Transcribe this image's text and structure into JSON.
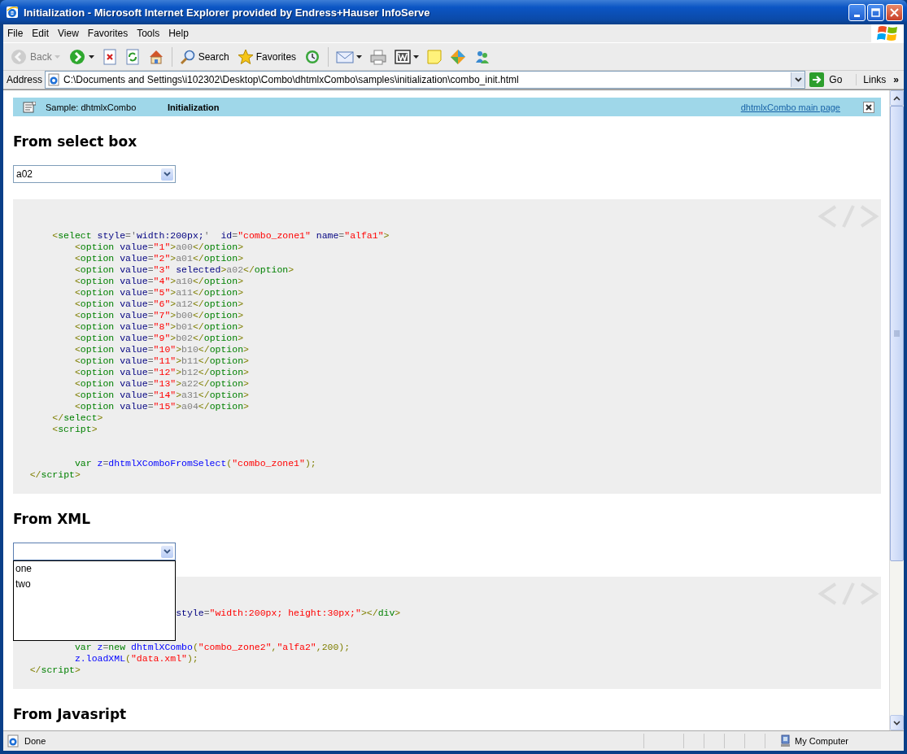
{
  "window": {
    "title": "Initialization - Microsoft Internet Explorer provided by Endress+Hauser InfoServe"
  },
  "menu": [
    "File",
    "Edit",
    "View",
    "Favorites",
    "Tools",
    "Help"
  ],
  "toolbar": [
    {
      "kind": "back",
      "label": "Back",
      "disabled": true,
      "menu": true
    },
    {
      "kind": "forward",
      "disabled": false,
      "menu": true
    },
    {
      "kind": "stop",
      "disabled": false,
      "menu": false
    },
    {
      "kind": "refresh",
      "disabled": false,
      "menu": false
    },
    {
      "kind": "home",
      "disabled": false,
      "menu": false
    },
    {
      "kind": "separator"
    },
    {
      "kind": "search",
      "label": "Search",
      "disabled": false,
      "menu": false
    },
    {
      "kind": "favorites",
      "label": "Favorites",
      "disabled": false,
      "menu": false
    },
    {
      "kind": "history",
      "disabled": false,
      "menu": false
    },
    {
      "kind": "separator"
    },
    {
      "kind": "mail",
      "disabled": false,
      "menu": true
    },
    {
      "kind": "print",
      "disabled": false,
      "menu": false
    },
    {
      "kind": "word",
      "disabled": false,
      "menu": true
    },
    {
      "kind": "note",
      "disabled": false,
      "menu": false
    },
    {
      "kind": "messenger",
      "disabled": false,
      "menu": false
    },
    {
      "kind": "people",
      "disabled": false,
      "menu": false
    }
  ],
  "address": {
    "label": "Address",
    "url": "C:\\Documents and Settings\\i102302\\Desktop\\Combo\\dhtmlxCombo\\samples\\initialization\\combo_init.html",
    "go": "Go",
    "links": "Links",
    "more": "»"
  },
  "sample_bar": {
    "caption": "Sample: dhtmlxCombo",
    "title": "Initialization",
    "link": "dhtmlxCombo main page"
  },
  "sections": [
    {
      "heading": "From select box",
      "combo": {
        "value": "a02",
        "open": false
      },
      "code": [
        {
          "tokens": [
            {
              "kind": "punct",
              "text": "       <"
            },
            {
              "kind": "tag",
              "text": "select"
            },
            {
              "kind": "attr",
              "text": " style"
            },
            {
              "kind": "op",
              "text": "='"
            },
            {
              "kind": "attr",
              "text": "width:200px;"
            },
            {
              "kind": "op",
              "text": "'"
            },
            {
              "kind": "attr",
              "text": "  id"
            },
            {
              "kind": "op",
              "text": "="
            },
            {
              "kind": "str",
              "text": "\"combo_zone1\""
            },
            {
              "kind": "attr",
              "text": " name"
            },
            {
              "kind": "op",
              "text": "="
            },
            {
              "kind": "str",
              "text": "\"alfa1\""
            },
            {
              "kind": "punct",
              "text": ">"
            }
          ]
        },
        {
          "tokens": [
            {
              "kind": "punct",
              "text": "           <"
            },
            {
              "kind": "tag",
              "text": "option"
            },
            {
              "kind": "attr",
              "text": " value"
            },
            {
              "kind": "op",
              "text": "="
            },
            {
              "kind": "str",
              "text": "\"1\""
            },
            {
              "kind": "punct",
              "text": ">"
            },
            {
              "kind": "text",
              "text": "a00"
            },
            {
              "kind": "punct",
              "text": "</"
            },
            {
              "kind": "tag",
              "text": "option"
            },
            {
              "kind": "punct",
              "text": ">"
            }
          ]
        },
        {
          "tokens": [
            {
              "kind": "punct",
              "text": "           <"
            },
            {
              "kind": "tag",
              "text": "option"
            },
            {
              "kind": "attr",
              "text": " value"
            },
            {
              "kind": "op",
              "text": "="
            },
            {
              "kind": "str",
              "text": "\"2\""
            },
            {
              "kind": "punct",
              "text": ">"
            },
            {
              "kind": "text",
              "text": "a01"
            },
            {
              "kind": "punct",
              "text": "</"
            },
            {
              "kind": "tag",
              "text": "option"
            },
            {
              "kind": "punct",
              "text": ">"
            }
          ]
        },
        {
          "tokens": [
            {
              "kind": "punct",
              "text": "           <"
            },
            {
              "kind": "tag",
              "text": "option"
            },
            {
              "kind": "attr",
              "text": " value"
            },
            {
              "kind": "op",
              "text": "="
            },
            {
              "kind": "str",
              "text": "\"3\""
            },
            {
              "kind": "attr",
              "text": " selected"
            },
            {
              "kind": "punct",
              "text": ">"
            },
            {
              "kind": "text",
              "text": "a02"
            },
            {
              "kind": "punct",
              "text": "</"
            },
            {
              "kind": "tag",
              "text": "option"
            },
            {
              "kind": "punct",
              "text": ">"
            }
          ]
        },
        {
          "tokens": [
            {
              "kind": "punct",
              "text": "           <"
            },
            {
              "kind": "tag",
              "text": "option"
            },
            {
              "kind": "attr",
              "text": " value"
            },
            {
              "kind": "op",
              "text": "="
            },
            {
              "kind": "str",
              "text": "\"4\""
            },
            {
              "kind": "punct",
              "text": ">"
            },
            {
              "kind": "text",
              "text": "a10"
            },
            {
              "kind": "punct",
              "text": "</"
            },
            {
              "kind": "tag",
              "text": "option"
            },
            {
              "kind": "punct",
              "text": ">"
            }
          ]
        },
        {
          "tokens": [
            {
              "kind": "punct",
              "text": "           <"
            },
            {
              "kind": "tag",
              "text": "option"
            },
            {
              "kind": "attr",
              "text": " value"
            },
            {
              "kind": "op",
              "text": "="
            },
            {
              "kind": "str",
              "text": "\"5\""
            },
            {
              "kind": "punct",
              "text": ">"
            },
            {
              "kind": "text",
              "text": "a11"
            },
            {
              "kind": "punct",
              "text": "</"
            },
            {
              "kind": "tag",
              "text": "option"
            },
            {
              "kind": "punct",
              "text": ">"
            }
          ]
        },
        {
          "tokens": [
            {
              "kind": "punct",
              "text": "           <"
            },
            {
              "kind": "tag",
              "text": "option"
            },
            {
              "kind": "attr",
              "text": " value"
            },
            {
              "kind": "op",
              "text": "="
            },
            {
              "kind": "str",
              "text": "\"6\""
            },
            {
              "kind": "punct",
              "text": ">"
            },
            {
              "kind": "text",
              "text": "a12"
            },
            {
              "kind": "punct",
              "text": "</"
            },
            {
              "kind": "tag",
              "text": "option"
            },
            {
              "kind": "punct",
              "text": ">"
            }
          ]
        },
        {
          "tokens": [
            {
              "kind": "punct",
              "text": "           <"
            },
            {
              "kind": "tag",
              "text": "option"
            },
            {
              "kind": "attr",
              "text": " value"
            },
            {
              "kind": "op",
              "text": "="
            },
            {
              "kind": "str",
              "text": "\"7\""
            },
            {
              "kind": "punct",
              "text": ">"
            },
            {
              "kind": "text",
              "text": "b00"
            },
            {
              "kind": "punct",
              "text": "</"
            },
            {
              "kind": "tag",
              "text": "option"
            },
            {
              "kind": "punct",
              "text": ">"
            }
          ]
        },
        {
          "tokens": [
            {
              "kind": "punct",
              "text": "           <"
            },
            {
              "kind": "tag",
              "text": "option"
            },
            {
              "kind": "attr",
              "text": " value"
            },
            {
              "kind": "op",
              "text": "="
            },
            {
              "kind": "str",
              "text": "\"8\""
            },
            {
              "kind": "punct",
              "text": ">"
            },
            {
              "kind": "text",
              "text": "b01"
            },
            {
              "kind": "punct",
              "text": "</"
            },
            {
              "kind": "tag",
              "text": "option"
            },
            {
              "kind": "punct",
              "text": ">"
            }
          ]
        },
        {
          "tokens": [
            {
              "kind": "punct",
              "text": "           <"
            },
            {
              "kind": "tag",
              "text": "option"
            },
            {
              "kind": "attr",
              "text": " value"
            },
            {
              "kind": "op",
              "text": "="
            },
            {
              "kind": "str",
              "text": "\"9\""
            },
            {
              "kind": "punct",
              "text": ">"
            },
            {
              "kind": "text",
              "text": "b02"
            },
            {
              "kind": "punct",
              "text": "</"
            },
            {
              "kind": "tag",
              "text": "option"
            },
            {
              "kind": "punct",
              "text": ">"
            }
          ]
        },
        {
          "tokens": [
            {
              "kind": "punct",
              "text": "           <"
            },
            {
              "kind": "tag",
              "text": "option"
            },
            {
              "kind": "attr",
              "text": " value"
            },
            {
              "kind": "op",
              "text": "="
            },
            {
              "kind": "str",
              "text": "\"10\""
            },
            {
              "kind": "punct",
              "text": ">"
            },
            {
              "kind": "text",
              "text": "b10"
            },
            {
              "kind": "punct",
              "text": "</"
            },
            {
              "kind": "tag",
              "text": "option"
            },
            {
              "kind": "punct",
              "text": ">"
            }
          ]
        },
        {
          "tokens": [
            {
              "kind": "punct",
              "text": "           <"
            },
            {
              "kind": "tag",
              "text": "option"
            },
            {
              "kind": "attr",
              "text": " value"
            },
            {
              "kind": "op",
              "text": "="
            },
            {
              "kind": "str",
              "text": "\"11\""
            },
            {
              "kind": "punct",
              "text": ">"
            },
            {
              "kind": "text",
              "text": "b11"
            },
            {
              "kind": "punct",
              "text": "</"
            },
            {
              "kind": "tag",
              "text": "option"
            },
            {
              "kind": "punct",
              "text": ">"
            }
          ]
        },
        {
          "tokens": [
            {
              "kind": "punct",
              "text": "           <"
            },
            {
              "kind": "tag",
              "text": "option"
            },
            {
              "kind": "attr",
              "text": " value"
            },
            {
              "kind": "op",
              "text": "="
            },
            {
              "kind": "str",
              "text": "\"12\""
            },
            {
              "kind": "punct",
              "text": ">"
            },
            {
              "kind": "text",
              "text": "b12"
            },
            {
              "kind": "punct",
              "text": "</"
            },
            {
              "kind": "tag",
              "text": "option"
            },
            {
              "kind": "punct",
              "text": ">"
            }
          ]
        },
        {
          "tokens": [
            {
              "kind": "punct",
              "text": "           <"
            },
            {
              "kind": "tag",
              "text": "option"
            },
            {
              "kind": "attr",
              "text": " value"
            },
            {
              "kind": "op",
              "text": "="
            },
            {
              "kind": "str",
              "text": "\"13\""
            },
            {
              "kind": "punct",
              "text": ">"
            },
            {
              "kind": "text",
              "text": "a22"
            },
            {
              "kind": "punct",
              "text": "</"
            },
            {
              "kind": "tag",
              "text": "option"
            },
            {
              "kind": "punct",
              "text": ">"
            }
          ]
        },
        {
          "tokens": [
            {
              "kind": "punct",
              "text": "           <"
            },
            {
              "kind": "tag",
              "text": "option"
            },
            {
              "kind": "attr",
              "text": " value"
            },
            {
              "kind": "op",
              "text": "="
            },
            {
              "kind": "str",
              "text": "\"14\""
            },
            {
              "kind": "punct",
              "text": ">"
            },
            {
              "kind": "text",
              "text": "a31"
            },
            {
              "kind": "punct",
              "text": "</"
            },
            {
              "kind": "tag",
              "text": "option"
            },
            {
              "kind": "punct",
              "text": ">"
            }
          ]
        },
        {
          "tokens": [
            {
              "kind": "punct",
              "text": "           <"
            },
            {
              "kind": "tag",
              "text": "option"
            },
            {
              "kind": "attr",
              "text": " value"
            },
            {
              "kind": "op",
              "text": "="
            },
            {
              "kind": "str",
              "text": "\"15\""
            },
            {
              "kind": "punct",
              "text": ">"
            },
            {
              "kind": "text",
              "text": "a04"
            },
            {
              "kind": "punct",
              "text": "</"
            },
            {
              "kind": "tag",
              "text": "option"
            },
            {
              "kind": "punct",
              "text": ">"
            }
          ]
        },
        {
          "tokens": [
            {
              "kind": "punct",
              "text": "       </"
            },
            {
              "kind": "tag",
              "text": "select"
            },
            {
              "kind": "punct",
              "text": ">"
            }
          ]
        },
        {
          "tokens": [
            {
              "kind": "punct",
              "text": "       <"
            },
            {
              "kind": "tag",
              "text": "script"
            },
            {
              "kind": "punct",
              "text": ">"
            }
          ]
        },
        {
          "blank_before": true,
          "tokens": [
            {
              "kind": "kw",
              "text": "           var"
            },
            {
              "kind": "func",
              "text": " z"
            },
            {
              "kind": "op",
              "text": "="
            },
            {
              "kind": "func",
              "text": "dhtmlXComboFromSelect"
            },
            {
              "kind": "punct",
              "text": "("
            },
            {
              "kind": "str",
              "text": "\"combo_zone1\""
            },
            {
              "kind": "punct",
              "text": ");"
            }
          ]
        },
        {
          "tokens": [
            {
              "kind": "punct",
              "text": "   </"
            },
            {
              "kind": "tag",
              "text": "script"
            },
            {
              "kind": "punct",
              "text": ">"
            }
          ]
        }
      ]
    },
    {
      "heading": "From XML",
      "combo": {
        "open": true,
        "options": [
          {
            "label": "one",
            "selected": false
          },
          {
            "label": "two",
            "selected": false
          }
        ]
      },
      "code": [
        {
          "tokens": [
            {
              "kind": "attr",
              "text": "                             style"
            },
            {
              "kind": "op",
              "text": "="
            },
            {
              "kind": "str",
              "text": "\"width:200px; height:30px;\""
            },
            {
              "kind": "punct",
              "text": "></"
            },
            {
              "kind": "tag",
              "text": "div"
            },
            {
              "kind": "punct",
              "text": ">"
            }
          ]
        },
        {
          "blank_before": true,
          "tokens": [
            {
              "kind": "kw",
              "text": "           var"
            },
            {
              "kind": "func",
              "text": " z"
            },
            {
              "kind": "op",
              "text": "="
            },
            {
              "kind": "kw",
              "text": "new"
            },
            {
              "kind": "func",
              "text": " dhtmlXCombo"
            },
            {
              "kind": "punct",
              "text": "("
            },
            {
              "kind": "str",
              "text": "\"combo_zone2\""
            },
            {
              "kind": "punct",
              "text": ","
            },
            {
              "kind": "str",
              "text": "\"alfa2\""
            },
            {
              "kind": "punct",
              "text": ",200);"
            }
          ]
        },
        {
          "tokens": [
            {
              "kind": "func",
              "text": "           z.loadXML"
            },
            {
              "kind": "punct",
              "text": "("
            },
            {
              "kind": "str",
              "text": "\"data.xml\""
            },
            {
              "kind": "punct",
              "text": ");"
            }
          ]
        },
        {
          "tokens": [
            {
              "kind": "punct",
              "text": "   </"
            },
            {
              "kind": "tag",
              "text": "script"
            },
            {
              "kind": "punct",
              "text": ">"
            }
          ]
        }
      ]
    },
    {
      "heading": "From Javasript"
    }
  ],
  "status_bar": {
    "text": "Done",
    "zone": "My Computer"
  }
}
